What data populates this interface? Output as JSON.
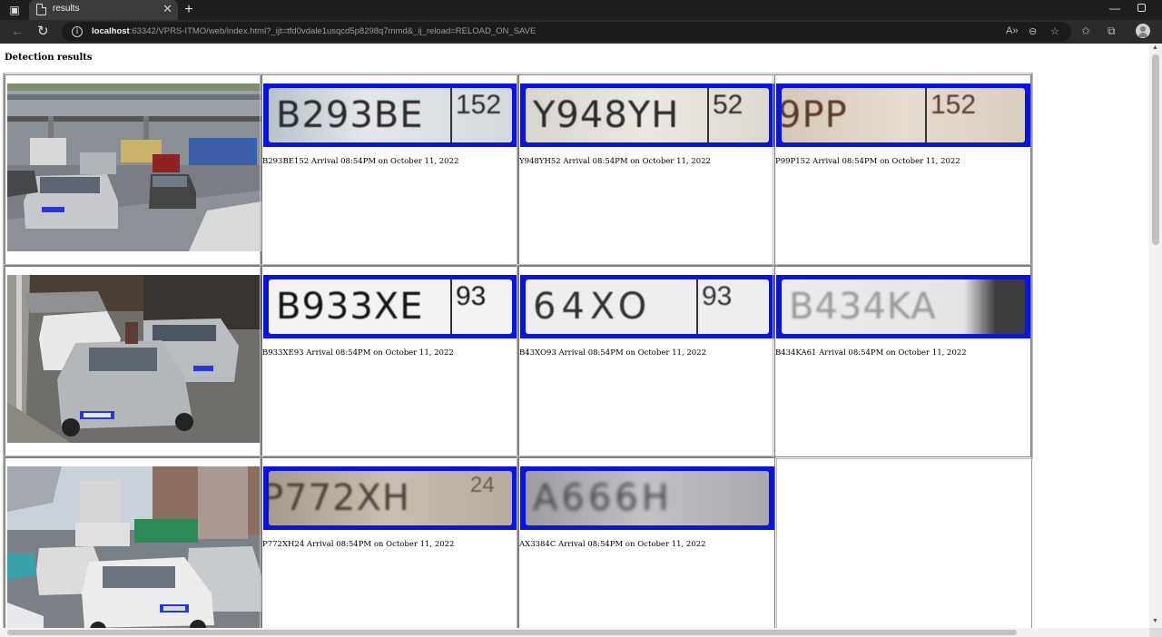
{
  "browser": {
    "tab_title": "results",
    "url_host": "localhost",
    "url_rest": ":63342/VPRS-ITMO/web/index.html?_ijt=tfd0vdale1usqcd5p8298q7mmd&_ij_reload=RELOAD_ON_SAVE"
  },
  "page": {
    "heading": "Detection results"
  },
  "rows": [
    {
      "detections": [
        {
          "plate": "B293BE",
          "region": "152",
          "caption": "B293BE152 Arrival 08:54PM on October 11, 2022"
        },
        {
          "plate": "Y948YH",
          "region": "52",
          "caption": "Y948YH52 Arrival 08:54PM on October 11, 2022"
        },
        {
          "plate": "9PP",
          "region": "152",
          "caption": "P99P152 Arrival 08:54PM on October 11, 2022"
        }
      ]
    },
    {
      "detections": [
        {
          "plate": "B933XE",
          "region": "93",
          "caption": "B933XE93 Arrival 08:54PM on October 11, 2022"
        },
        {
          "plate": "64XO",
          "region": "93",
          "caption": "B43XO93 Arrival 08:54PM on October 11, 2022"
        },
        {
          "plate": "B434KA",
          "region": "",
          "caption": "B434KA61 Arrival 08:54PM on October 11, 2022"
        }
      ]
    },
    {
      "detections": [
        {
          "plate": "P772XH",
          "region": "24",
          "caption": "P772XH24 Arrival 08:54PM on October 11, 2022"
        },
        {
          "plate": "A666H",
          "region": "",
          "caption": "AX3384C Arrival 08:54PM on October 11, 2022"
        }
      ]
    }
  ],
  "colors": {
    "plate_frame": "#0a14e0",
    "chrome_dark": "#1f1f1f"
  }
}
